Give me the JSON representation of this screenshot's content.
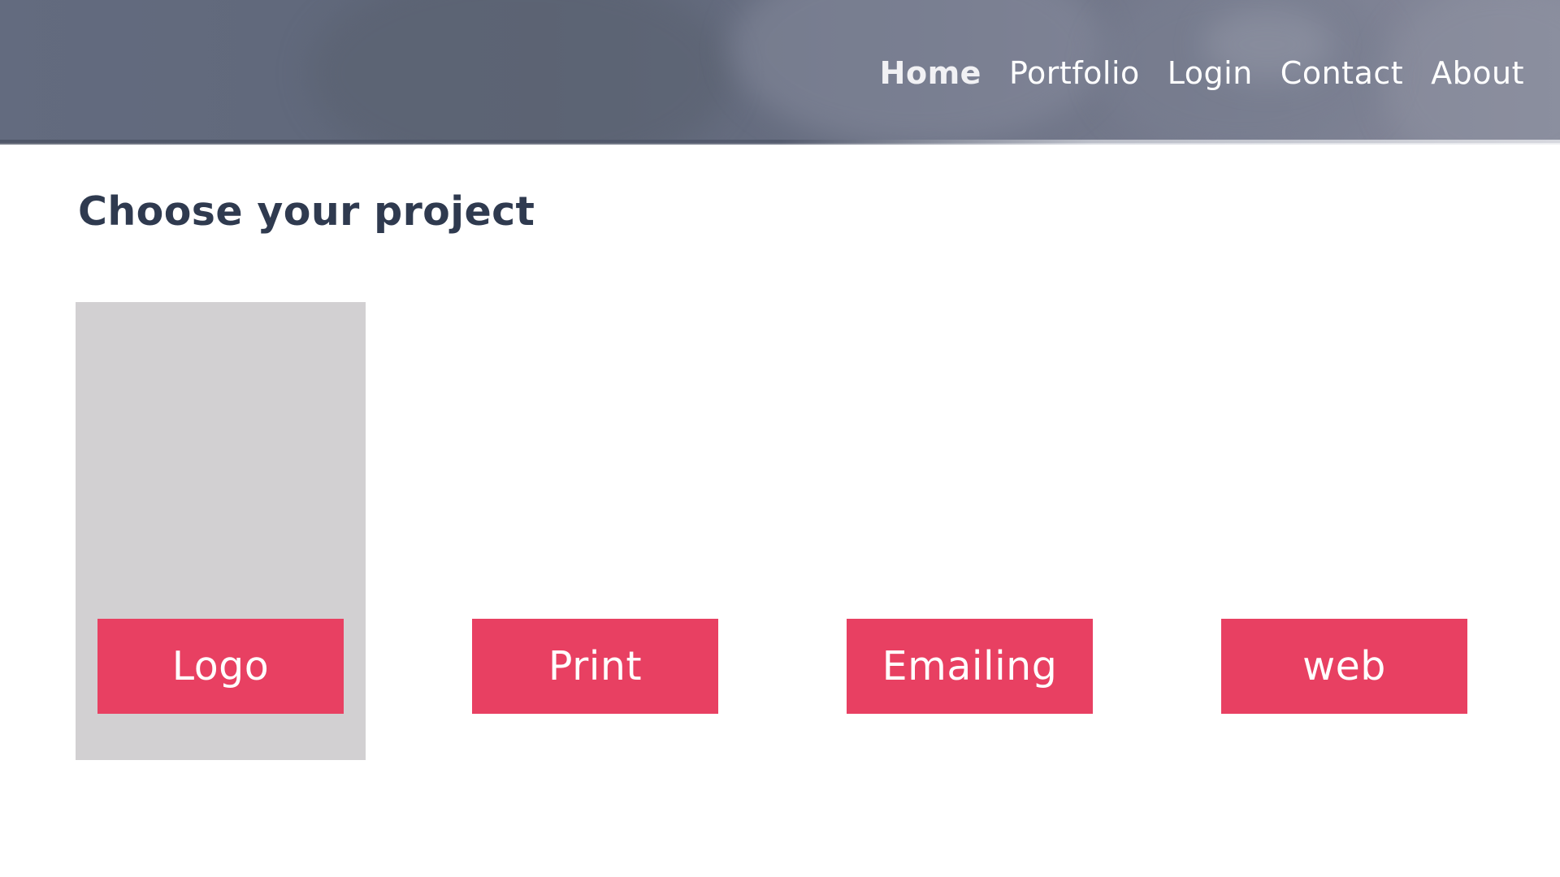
{
  "nav": {
    "items": [
      {
        "label": "Home",
        "active": true
      },
      {
        "label": "Portfolio",
        "active": false
      },
      {
        "label": "Login",
        "active": false
      },
      {
        "label": "Contact",
        "active": false
      },
      {
        "label": "About",
        "active": false
      }
    ]
  },
  "main": {
    "title": "Choose your project",
    "projects": [
      {
        "label": "Logo",
        "highlighted": true
      },
      {
        "label": "Print",
        "highlighted": false
      },
      {
        "label": "Emailing",
        "highlighted": false
      },
      {
        "label": "web",
        "highlighted": false
      }
    ]
  },
  "colors": {
    "header_tint": "#636b7f",
    "title_text": "#2f3a4f",
    "button_bg": "#e84062",
    "button_text": "#ffffff",
    "highlight_card": "#d2d0d2"
  }
}
